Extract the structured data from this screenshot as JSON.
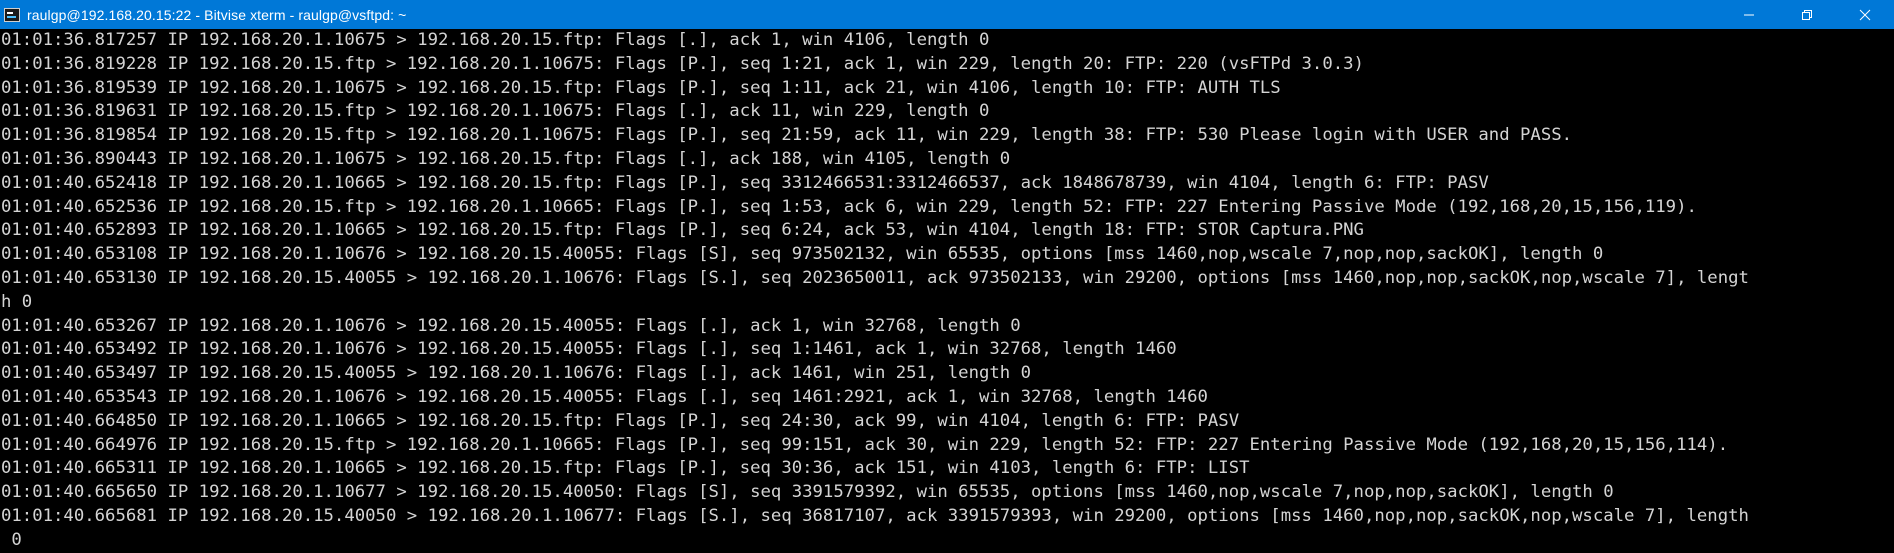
{
  "window": {
    "title": "raulgp@192.168.20.15:22 - Bitvise xterm - raulgp@vsftpd: ~",
    "icon": "terminal-app-icon",
    "controls": {
      "minimize_icon": "minimize-icon",
      "maximize_icon": "restore-icon",
      "close_icon": "close-icon"
    },
    "titlebar_color": "#0078d7"
  },
  "terminal": {
    "background": "#000000",
    "foreground": "#d4d4d4",
    "lines": [
      "01:01:36.817257 IP 192.168.20.1.10675 > 192.168.20.15.ftp: Flags [.], ack 1, win 4106, length 0",
      "01:01:36.819228 IP 192.168.20.15.ftp > 192.168.20.1.10675: Flags [P.], seq 1:21, ack 1, win 229, length 20: FTP: 220 (vsFTPd 3.0.3)",
      "01:01:36.819539 IP 192.168.20.1.10675 > 192.168.20.15.ftp: Flags [P.], seq 1:11, ack 21, win 4106, length 10: FTP: AUTH TLS",
      "01:01:36.819631 IP 192.168.20.15.ftp > 192.168.20.1.10675: Flags [.], ack 11, win 229, length 0",
      "01:01:36.819854 IP 192.168.20.15.ftp > 192.168.20.1.10675: Flags [P.], seq 21:59, ack 11, win 229, length 38: FTP: 530 Please login with USER and PASS.",
      "01:01:36.890443 IP 192.168.20.1.10675 > 192.168.20.15.ftp: Flags [.], ack 188, win 4105, length 0",
      "01:01:40.652418 IP 192.168.20.1.10665 > 192.168.20.15.ftp: Flags [P.], seq 3312466531:3312466537, ack 1848678739, win 4104, length 6: FTP: PASV",
      "01:01:40.652536 IP 192.168.20.15.ftp > 192.168.20.1.10665: Flags [P.], seq 1:53, ack 6, win 229, length 52: FTP: 227 Entering Passive Mode (192,168,20,15,156,119).",
      "01:01:40.652893 IP 192.168.20.1.10665 > 192.168.20.15.ftp: Flags [P.], seq 6:24, ack 53, win 4104, length 18: FTP: STOR Captura.PNG",
      "01:01:40.653108 IP 192.168.20.1.10676 > 192.168.20.15.40055: Flags [S], seq 973502132, win 65535, options [mss 1460,nop,wscale 7,nop,nop,sackOK], length 0",
      "01:01:40.653130 IP 192.168.20.15.40055 > 192.168.20.1.10676: Flags [S.], seq 2023650011, ack 973502133, win 29200, options [mss 1460,nop,nop,sackOK,nop,wscale 7], lengt",
      "h 0",
      "01:01:40.653267 IP 192.168.20.1.10676 > 192.168.20.15.40055: Flags [.], ack 1, win 32768, length 0",
      "01:01:40.653492 IP 192.168.20.1.10676 > 192.168.20.15.40055: Flags [.], seq 1:1461, ack 1, win 32768, length 1460",
      "01:01:40.653497 IP 192.168.20.15.40055 > 192.168.20.1.10676: Flags [.], ack 1461, win 251, length 0",
      "01:01:40.653543 IP 192.168.20.1.10676 > 192.168.20.15.40055: Flags [.], seq 1461:2921, ack 1, win 32768, length 1460",
      "01:01:40.664850 IP 192.168.20.1.10665 > 192.168.20.15.ftp: Flags [P.], seq 24:30, ack 99, win 4104, length 6: FTP: PASV",
      "01:01:40.664976 IP 192.168.20.15.ftp > 192.168.20.1.10665: Flags [P.], seq 99:151, ack 30, win 229, length 52: FTP: 227 Entering Passive Mode (192,168,20,15,156,114).",
      "01:01:40.665311 IP 192.168.20.1.10665 > 192.168.20.15.ftp: Flags [P.], seq 30:36, ack 151, win 4103, length 6: FTP: LIST",
      "01:01:40.665650 IP 192.168.20.1.10677 > 192.168.20.15.40050: Flags [S], seq 3391579392, win 65535, options [mss 1460,nop,wscale 7,nop,nop,sackOK], length 0",
      "01:01:40.665681 IP 192.168.20.15.40050 > 192.168.20.1.10677: Flags [S.], seq 36817107, ack 3391579393, win 29200, options [mss 1460,nop,nop,sackOK,nop,wscale 7], length",
      " 0"
    ]
  }
}
